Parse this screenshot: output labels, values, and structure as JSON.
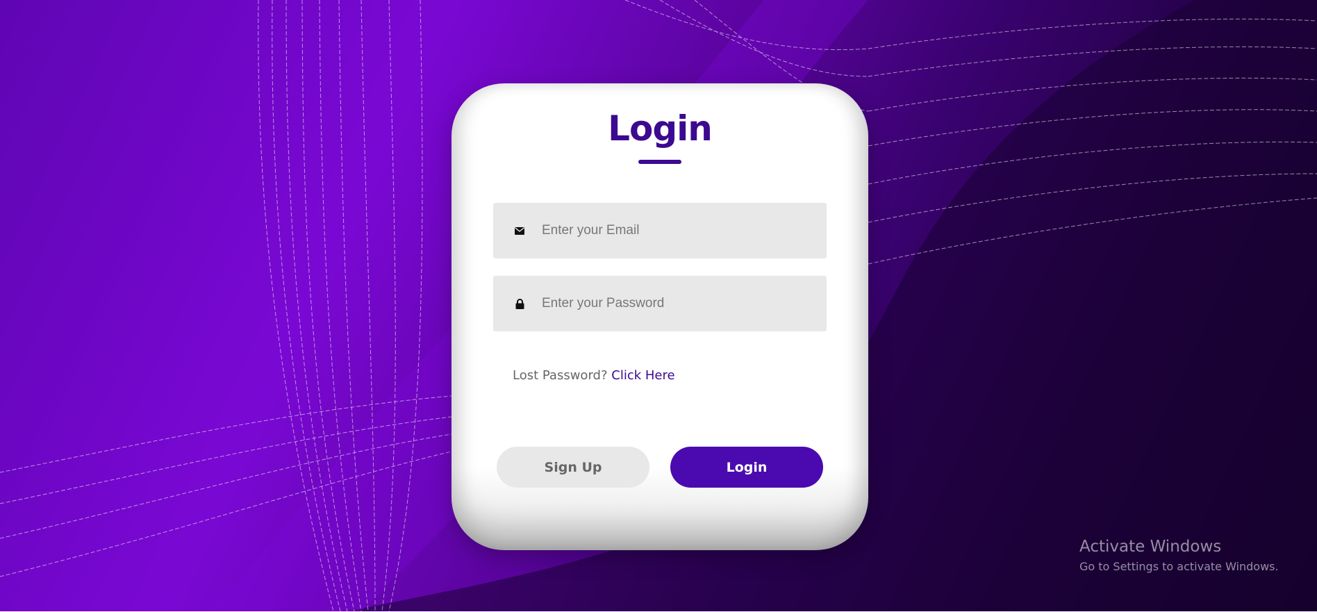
{
  "login_card": {
    "title": "Login",
    "email_field": {
      "placeholder": "Enter your Email",
      "icon": "envelope-icon"
    },
    "password_field": {
      "placeholder": "Enter your Password",
      "icon": "lock-icon"
    },
    "lost_password": {
      "text": "Lost Password?",
      "link": "Click Here"
    },
    "buttons": {
      "signup_label": "Sign Up",
      "login_label": "Login"
    }
  },
  "watermark": {
    "title": "Activate Windows",
    "subtitle": "Go to Settings to activate Windows."
  },
  "colors": {
    "accent": "#3c0991",
    "login_button": "#4a0aaf",
    "field_bg": "#e8e8e8",
    "background_purple": "#7a08d4",
    "background_dark": "#120127"
  }
}
